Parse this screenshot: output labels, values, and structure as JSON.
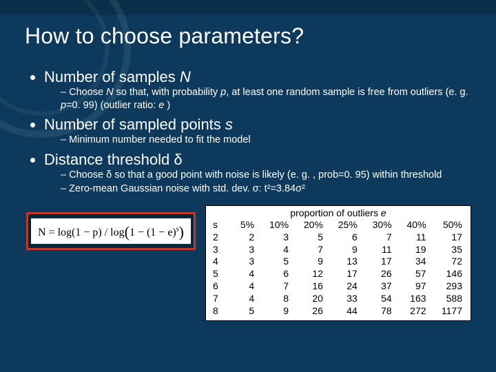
{
  "title": "How to choose parameters?",
  "bullets": {
    "n": {
      "label": "Number of samples ",
      "var": "N",
      "sub1a": "Choose ",
      "sub1var": "N",
      "sub1b": " so that, with probability ",
      "sub1pvar": "p",
      "sub1c": ", at least one random sample is free from outliers (e. g. ",
      "sub1d": "p",
      "sub1e": "=0. 99) (outlier ratio: ",
      "sub1f": "e",
      "sub1g": " )"
    },
    "s": {
      "label": "Number of sampled points ",
      "var": "s",
      "sub1": "Minimum number needed to fit the model"
    },
    "d": {
      "label": "Distance threshold ",
      "var": "δ",
      "sub1a": "Choose ",
      "sub1var": "δ",
      "sub1b": " so that a good point with noise is likely (e. g. , prob=0. 95) within threshold",
      "sub2": "Zero-mean Gaussian noise with std. dev. σ: t²=3.84σ²"
    }
  },
  "formula": {
    "lhs": "N = log(1 − p) / log",
    "open": "(",
    "inner": "1 − (1 − e)",
    "sup": "s",
    "close": ")"
  },
  "table": {
    "caption_a": "proportion of outliers ",
    "caption_var": "e",
    "head_s": "s",
    "cols": [
      "5%",
      "10%",
      "20%",
      "25%",
      "30%",
      "40%",
      "50%"
    ],
    "rows": [
      {
        "s": "2",
        "v": [
          "2",
          "3",
          "5",
          "6",
          "7",
          "11",
          "17"
        ]
      },
      {
        "s": "3",
        "v": [
          "3",
          "4",
          "7",
          "9",
          "11",
          "19",
          "35"
        ]
      },
      {
        "s": "4",
        "v": [
          "3",
          "5",
          "9",
          "13",
          "17",
          "34",
          "72"
        ]
      },
      {
        "s": "5",
        "v": [
          "4",
          "6",
          "12",
          "17",
          "26",
          "57",
          "146"
        ]
      },
      {
        "s": "6",
        "v": [
          "4",
          "7",
          "16",
          "24",
          "37",
          "97",
          "293"
        ]
      },
      {
        "s": "7",
        "v": [
          "4",
          "8",
          "20",
          "33",
          "54",
          "163",
          "588"
        ]
      },
      {
        "s": "8",
        "v": [
          "5",
          "9",
          "26",
          "44",
          "78",
          "272",
          "1177"
        ]
      }
    ]
  },
  "chart_data": {
    "type": "table",
    "title": "proportion of outliers e",
    "row_label": "s",
    "columns": [
      "5%",
      "10%",
      "20%",
      "25%",
      "30%",
      "40%",
      "50%"
    ],
    "rows": {
      "2": [
        2,
        3,
        5,
        6,
        7,
        11,
        17
      ],
      "3": [
        3,
        4,
        7,
        9,
        11,
        19,
        35
      ],
      "4": [
        3,
        5,
        9,
        13,
        17,
        34,
        72
      ],
      "5": [
        4,
        6,
        12,
        17,
        26,
        57,
        146
      ],
      "6": [
        4,
        7,
        16,
        24,
        37,
        97,
        293
      ],
      "7": [
        4,
        8,
        20,
        33,
        54,
        163,
        588
      ],
      "8": [
        5,
        9,
        26,
        44,
        78,
        272,
        1177
      ]
    }
  }
}
